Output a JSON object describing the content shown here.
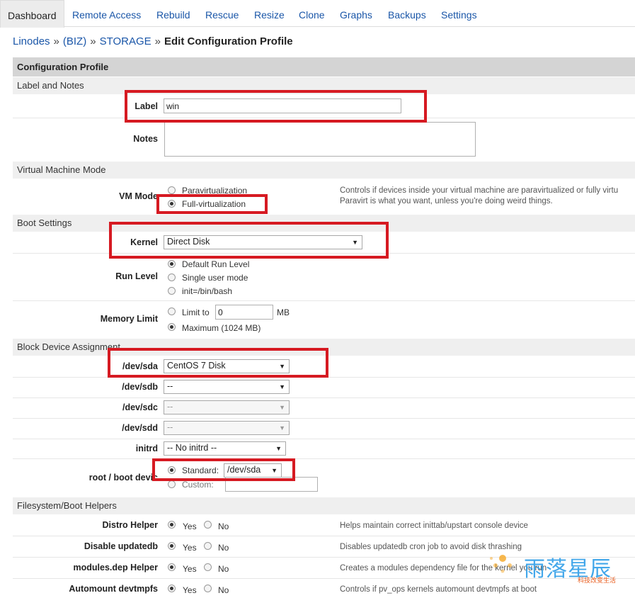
{
  "tabs": [
    "Dashboard",
    "Remote Access",
    "Rebuild",
    "Rescue",
    "Resize",
    "Clone",
    "Graphs",
    "Backups",
    "Settings"
  ],
  "breadcrumb": {
    "root": "Linodes",
    "sep": "»",
    "group": "(BIZ)",
    "linode": "STORAGE",
    "current": "Edit Configuration Profile"
  },
  "panel_title": "Configuration Profile",
  "sections": {
    "label_notes": "Label and Notes",
    "vm_mode": "Virtual Machine Mode",
    "boot": "Boot Settings",
    "block": "Block Device Assignment",
    "helpers": "Filesystem/Boot Helpers"
  },
  "label_field": {
    "label": "Label",
    "value": "win"
  },
  "notes_field": {
    "label": "Notes",
    "value": ""
  },
  "vm_mode": {
    "label": "VM Mode",
    "options": [
      "Paravirtualization",
      "Full-virtualization"
    ],
    "selected": "Full-virtualization",
    "help": [
      "Controls if devices inside your virtual machine are paravirtualized or fully virtu",
      "Paravirt is what you want, unless you're doing weird things."
    ]
  },
  "kernel": {
    "label": "Kernel",
    "value": "Direct Disk"
  },
  "run_level": {
    "label": "Run Level",
    "options": [
      "Default Run Level",
      "Single user mode",
      "init=/bin/bash"
    ],
    "selected": "Default Run Level"
  },
  "memory_limit": {
    "label": "Memory Limit",
    "limit_label": "Limit to",
    "limit_value": "0",
    "unit": "MB",
    "max_label": "Maximum (1024 MB)",
    "selected": "max"
  },
  "devices": [
    {
      "label": "/dev/sda",
      "value": "CentOS 7 Disk",
      "disabled": false
    },
    {
      "label": "/dev/sdb",
      "value": "--",
      "disabled": false
    },
    {
      "label": "/dev/sdc",
      "value": "--",
      "disabled": true
    },
    {
      "label": "/dev/sdd",
      "value": "--",
      "disabled": true
    },
    {
      "label": "initrd",
      "value": "-- No initrd --",
      "disabled": false
    }
  ],
  "root_device": {
    "label": "root / boot devic",
    "standard_label": "Standard:",
    "standard_value": "/dev/sda",
    "custom_label": "Custom:",
    "custom_value": ""
  },
  "helpers": [
    {
      "label": "Distro Helper",
      "yes": "Yes",
      "no": "No",
      "help": "Helps maintain correct inittab/upstart console device"
    },
    {
      "label": "Disable updatedb",
      "yes": "Yes",
      "no": "No",
      "help": "Disables updatedb cron job to avoid disk thrashing"
    },
    {
      "label": "modules.dep Helper",
      "yes": "Yes",
      "no": "No",
      "help": "Creates a modules dependency file for the kernel you run"
    },
    {
      "label": "Automount devtmpfs",
      "yes": "Yes",
      "no": "No",
      "help": "Controls if pv_ops kernels automount devtmpfs at boot"
    }
  ],
  "watermark": {
    "title": "雨落星辰",
    "subtitle": "科技改变生活"
  },
  "colors": {
    "link": "#1a56a8",
    "highlight": "#d61a22",
    "panel": "#d4d4d4",
    "section": "#efefef"
  }
}
